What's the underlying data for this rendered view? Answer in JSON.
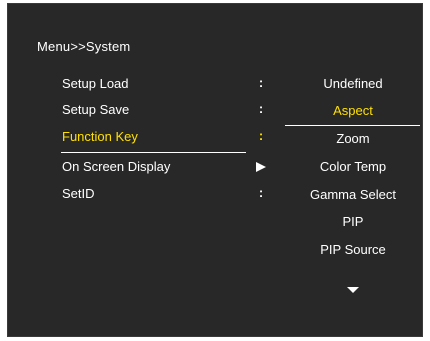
{
  "breadcrumb": "Menu>>System",
  "menu": {
    "items": [
      {
        "label": "Setup Load",
        "separator": ":"
      },
      {
        "label": "Setup Save",
        "separator": ":"
      },
      {
        "label": "Function Key",
        "separator": ":"
      },
      {
        "label": "On Screen Display",
        "separator": "arrow-right"
      },
      {
        "label": "SetID",
        "separator": ":"
      }
    ],
    "selected_index": 2
  },
  "options": {
    "items": [
      "Undefined",
      "Aspect",
      "Zoom",
      "Color Temp",
      "Gamma Select",
      "PIP",
      "PIP Source"
    ],
    "selected_index": 1,
    "more_indicator": "arrow-down"
  },
  "colors": {
    "background": "#282828",
    "text": "#ffffff",
    "highlight": "#ffe000"
  }
}
